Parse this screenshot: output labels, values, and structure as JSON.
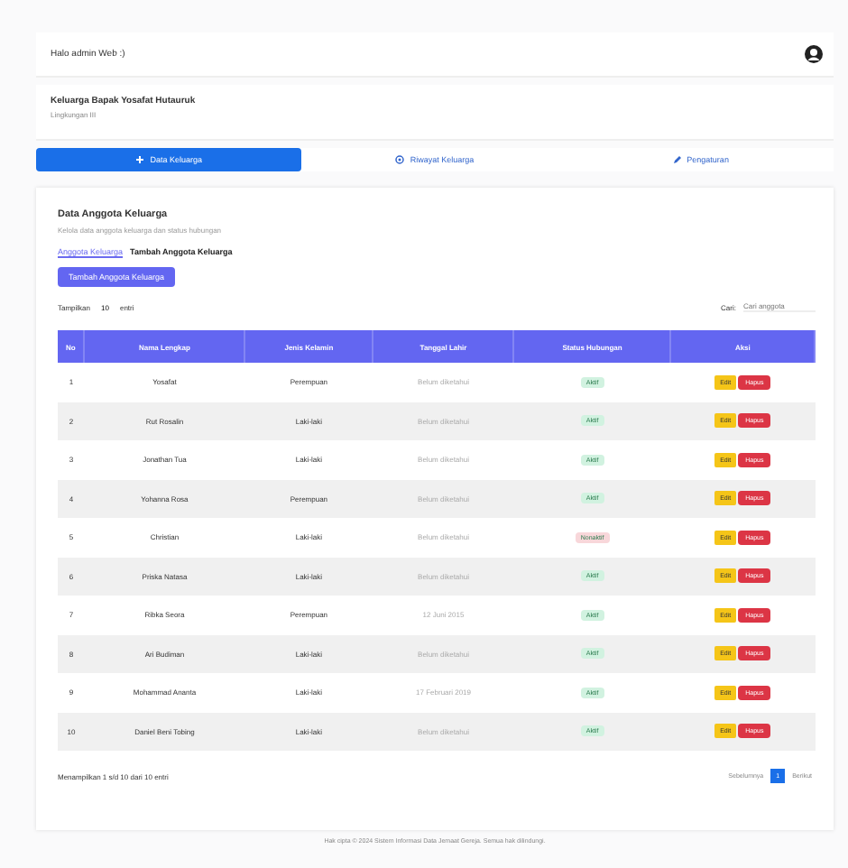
{
  "topbar": {
    "greeting": "Halo admin Web :)"
  },
  "header": {
    "title": "Keluarga Bapak Yosafat Hutauruk",
    "subtitle": "Lingkungan III"
  },
  "tabs": [
    {
      "label": "Data Keluarga",
      "kind": "plus",
      "selected": true
    },
    {
      "label": "Riwayat Keluarga",
      "kind": "circle",
      "selected": false
    },
    {
      "label": "Pengaturan",
      "kind": "pencil",
      "selected": false
    }
  ],
  "section": {
    "title": "Data Anggota Keluarga",
    "subtitle": "Kelola data anggota keluarga dan status hubungan"
  },
  "subtabs": [
    {
      "label": "Anggota Keluarga",
      "selected": true
    },
    {
      "label": "Tambah Anggota Keluarga",
      "selected": false
    }
  ],
  "add_button": "Tambah Anggota Keluarga",
  "length": {
    "before": "Tampilkan",
    "value": "10",
    "after": "entri"
  },
  "search": {
    "label": "Cari:",
    "placeholder": "Cari anggota"
  },
  "table": {
    "columns": [
      "No",
      "Nama Lengkap",
      "Jenis Kelamin",
      "Tanggal Lahir",
      "Status Hubungan",
      "Aksi"
    ],
    "rows": [
      {
        "no": "1",
        "name": "Yosafat",
        "gender": "Perempuan",
        "birth": "Belum diketahui",
        "status": "Aktif",
        "color": "#d1f2e0",
        "actions": [
          "Edit",
          "Hapus"
        ]
      },
      {
        "no": "2",
        "name": "Rut Rosalin",
        "gender": "Laki-laki",
        "birth": "Belum diketahui",
        "status": "Aktif",
        "color": "#d1f2e0",
        "actions": [
          "Edit",
          "Hapus"
        ]
      },
      {
        "no": "3",
        "name": "Jonathan Tua",
        "gender": "Laki-laki",
        "birth": "Belum diketahui",
        "status": "Aktif",
        "color": "#d1f2e0",
        "actions": [
          "Edit",
          "Hapus"
        ]
      },
      {
        "no": "4",
        "name": "Yohanna Rosa",
        "gender": "Perempuan",
        "birth": "Belum diketahui",
        "status": "Aktif",
        "color": "#d1f2e0",
        "actions": [
          "Edit",
          "Hapus"
        ]
      },
      {
        "no": "5",
        "name": "Christian",
        "gender": "Laki-laki",
        "birth": "Belum diketahui",
        "status": "Nonaktif",
        "color": "#f8d7da",
        "actions": [
          "Edit",
          "Hapus"
        ]
      },
      {
        "no": "6",
        "name": "Priska Natasa",
        "gender": "Laki-laki",
        "birth": "Belum diketahui",
        "status": "Aktif",
        "color": "#d1f2e0",
        "actions": [
          "Edit",
          "Hapus"
        ]
      },
      {
        "no": "7",
        "name": "Ribka Seora",
        "gender": "Perempuan",
        "birth": "12 Juni 2015",
        "status": "Aktif",
        "color": "#d1f2e0",
        "actions": [
          "Edit",
          "Hapus"
        ]
      },
      {
        "no": "8",
        "name": "Ari Budiman",
        "gender": "Laki-laki",
        "birth": "Belum diketahui",
        "status": "Aktif",
        "color": "#d1f2e0",
        "actions": [
          "Edit",
          "Hapus"
        ]
      },
      {
        "no": "9",
        "name": "Mohammad Ananta",
        "gender": "Laki-laki",
        "birth": "17 Februari 2019",
        "status": "Aktif",
        "color": "#d1f2e0",
        "actions": [
          "Edit",
          "Hapus"
        ]
      },
      {
        "no": "10",
        "name": "Daniel Beni Tobing",
        "gender": "Laki-laki",
        "birth": "Belum diketahui",
        "status": "Aktif",
        "color": "#d1f2e0",
        "actions": [
          "Edit",
          "Hapus"
        ]
      }
    ]
  },
  "info": "Menampilkan 1 s/d 10 dari 10 entri",
  "pagination": [
    {
      "label": "Sebelumnya",
      "selected": false
    },
    {
      "label": "1",
      "selected": true
    },
    {
      "label": "Berikut",
      "selected": false
    }
  ],
  "footer": "Hak cipta © 2024 Sistem Informasi Data Jemaat Gereja. Semua hak dilindungi."
}
